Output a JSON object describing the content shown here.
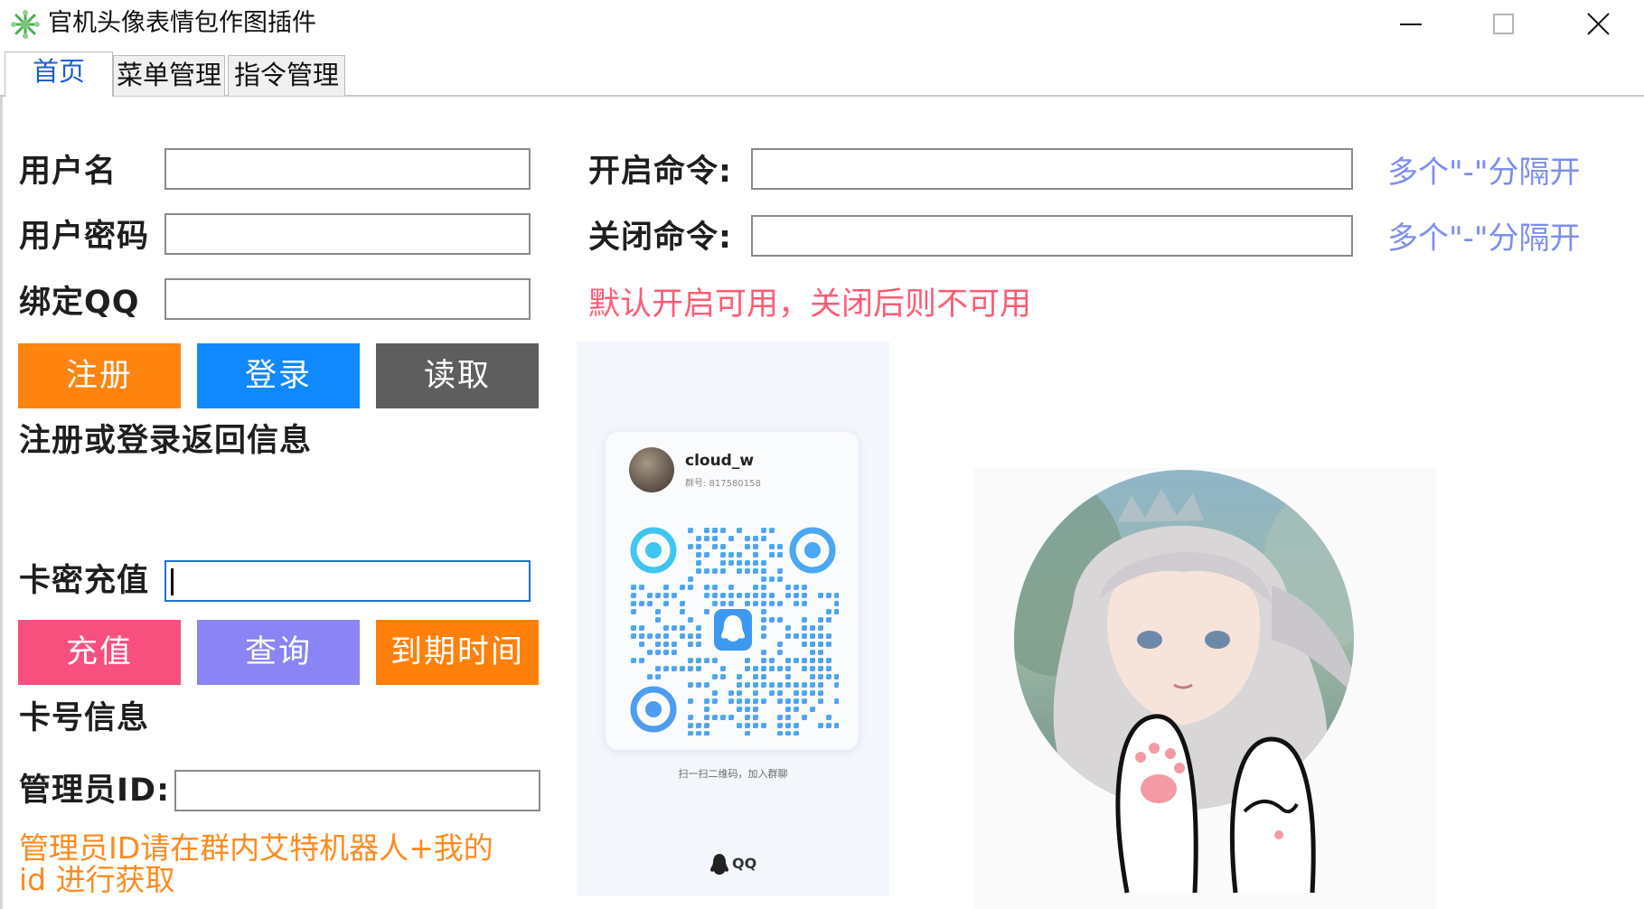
{
  "window": {
    "title": "官机头像表情包作图插件",
    "icon": "snowflake-icon"
  },
  "tabs": [
    {
      "label": "首页",
      "active": true
    },
    {
      "label": "菜单管理",
      "active": false
    },
    {
      "label": "指令管理",
      "active": false
    }
  ],
  "account": {
    "username_label": "用户名",
    "username_value": "",
    "password_label": "用户密码",
    "password_value": "",
    "bind_qq_label": "绑定QQ",
    "bind_qq_value": "",
    "register_label": "注册",
    "login_label": "登录",
    "read_label": "读取",
    "info_label": "注册或登录返回信息"
  },
  "card": {
    "label": "卡密充值",
    "value": "",
    "recharge_label": "充值",
    "query_label": "查询",
    "expire_label": "到期时间",
    "info_label": "卡号信息"
  },
  "admin": {
    "label": "管理员ID:",
    "value": "",
    "hint_line1": "管理员ID请在群内艾特机器人+我的",
    "hint_line2": "id 进行获取"
  },
  "commands": {
    "open_label": "开启命令:",
    "open_value": "",
    "open_hint": "多个\"-\"分隔开",
    "close_label": "关闭命令:",
    "close_value": "",
    "close_hint": "多个\"-\"分隔开",
    "notice": "默认开启可用，关闭后则不可用"
  },
  "qr_card": {
    "name": "cloud_w",
    "group_id": "群号: 817580158",
    "caption": "扫一扫二维码，加入群聊",
    "logo_text": "QQ"
  },
  "colors": {
    "register": "#ff8410",
    "login": "#1088ff",
    "read": "#5e5e5e",
    "recharge": "#f7507f",
    "query": "#8a84f4",
    "expire": "#ff800a",
    "hint_blue": "#7d8ef0",
    "notice_red": "#ff5c74",
    "hint_orange": "#ff8a1c",
    "tab_active": "#1a5fd0"
  }
}
